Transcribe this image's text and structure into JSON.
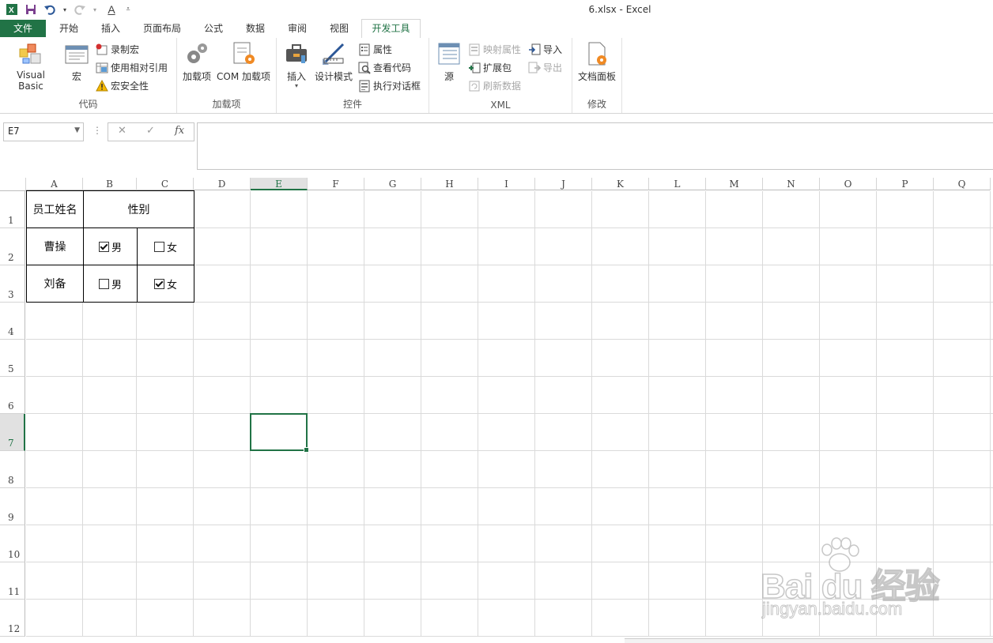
{
  "window": {
    "title": "6.xlsx - Excel"
  },
  "qat": {
    "excel_icon": "excel-logo-icon",
    "save_icon": "save-icon",
    "undo_icon": "undo-icon",
    "redo_icon": "redo-icon",
    "font_color_label": "A",
    "more_icon": "customize-qat-icon"
  },
  "tabs": [
    {
      "label": "文件"
    },
    {
      "label": "开始"
    },
    {
      "label": "插入"
    },
    {
      "label": "页面布局"
    },
    {
      "label": "公式"
    },
    {
      "label": "数据"
    },
    {
      "label": "审阅"
    },
    {
      "label": "视图"
    },
    {
      "label": "开发工具"
    }
  ],
  "ribbon": {
    "code": {
      "label": "代码",
      "visual_basic": "Visual Basic",
      "macros": "宏",
      "record_macro": "录制宏",
      "relative_refs": "使用相对引用",
      "macro_security": "宏安全性"
    },
    "addins": {
      "label": "加载项",
      "addins": "加载项",
      "com_addins": "COM 加载项"
    },
    "controls": {
      "label": "控件",
      "insert": "插入",
      "design_mode": "设计模式",
      "properties": "属性",
      "view_code": "查看代码",
      "run_dialog": "执行对话框"
    },
    "xml": {
      "label": "XML",
      "source": "源",
      "map_properties": "映射属性",
      "expansion_packs": "扩展包",
      "refresh_data": "刷新数据",
      "import": "导入",
      "export": "导出"
    },
    "modify": {
      "label": "修改",
      "document_panel": "文档面板"
    }
  },
  "formula_bar": {
    "name_box": "E7",
    "cancel": "✕",
    "enter": "✓",
    "fx": "fx",
    "value": ""
  },
  "columns": [
    "A",
    "B",
    "C",
    "D",
    "E",
    "F",
    "G",
    "H",
    "I",
    "J",
    "K",
    "L",
    "M",
    "N",
    "O",
    "P",
    "Q"
  ],
  "rows": [
    "1",
    "2",
    "3",
    "4",
    "5",
    "6",
    "7",
    "8",
    "9",
    "10",
    "11",
    "12"
  ],
  "selected_cell": "E7",
  "table": {
    "header_name": "员工姓名",
    "header_gender": "性别",
    "rows": [
      {
        "name": "曹操",
        "male_label": "男",
        "male_checked": true,
        "female_label": "女",
        "female_checked": false
      },
      {
        "name": "刘备",
        "male_label": "男",
        "male_checked": false,
        "female_label": "女",
        "female_checked": true
      }
    ]
  },
  "watermark": {
    "logo": "Bai du 经验",
    "url": "jingyan.baidu.com"
  }
}
